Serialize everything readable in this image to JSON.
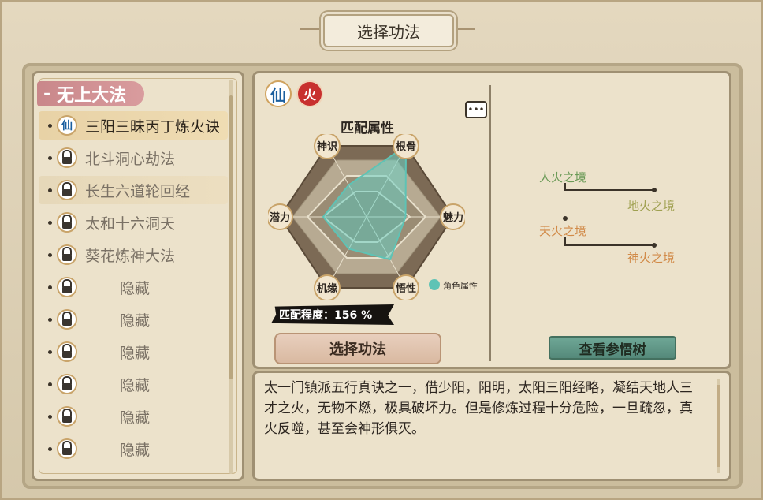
{
  "header": {
    "title": "选择功法"
  },
  "sidebar": {
    "category_label": "无上大法",
    "category_prefix": "-",
    "items": [
      {
        "label": "三阳三昧丙丁炼火诀",
        "icon": "xian-element-icon",
        "locked": false,
        "selected": true
      },
      {
        "label": "北斗洞心劫法",
        "icon": "lock-icon",
        "locked": true
      },
      {
        "label": "长生六道轮回经",
        "icon": "lock-icon",
        "locked": true
      },
      {
        "label": "太和十六洞天",
        "icon": "lock-icon",
        "locked": true
      },
      {
        "label": "葵花炼神大法",
        "icon": "lock-icon",
        "locked": true
      },
      {
        "label": "隐藏",
        "icon": "lock-icon",
        "locked": true
      },
      {
        "label": "隐藏",
        "icon": "lock-icon",
        "locked": true
      },
      {
        "label": "隐藏",
        "icon": "lock-icon",
        "locked": true
      },
      {
        "label": "隐藏",
        "icon": "lock-icon",
        "locked": true
      },
      {
        "label": "隐藏",
        "icon": "lock-icon",
        "locked": true
      },
      {
        "label": "隐藏",
        "icon": "lock-icon",
        "locked": true
      }
    ]
  },
  "detail": {
    "badge_type": "仙",
    "badge_element": "火",
    "radar_title": "匹配属性",
    "radar_axes": [
      "根骨",
      "魅力",
      "悟性",
      "机缘",
      "潜力",
      "神识"
    ],
    "radar_values": [
      1.0,
      0.45,
      0.6,
      0.45,
      0.5,
      0.45
    ],
    "legend_label": "角色属性",
    "match_label": "匹配程度：156 %",
    "select_button": "选择功法",
    "tree_button": "查看参悟树",
    "realms": [
      "人火之境",
      "地火之境",
      "天火之境",
      "神火之境"
    ],
    "description": "太一门镇派五行真诀之一，借少阳，阳明，太阳三阳经略，凝结天地人三才之火，无物不燃，极具破坏力。但是修炼过程十分危险，一旦疏忽，真火反噬，甚至会神形俱灭。"
  },
  "colors": {
    "accent_teal": "#5ec3b5",
    "button_green": "#5f9787",
    "category_pink": "#c9878a",
    "fire_red": "#c8302e"
  }
}
